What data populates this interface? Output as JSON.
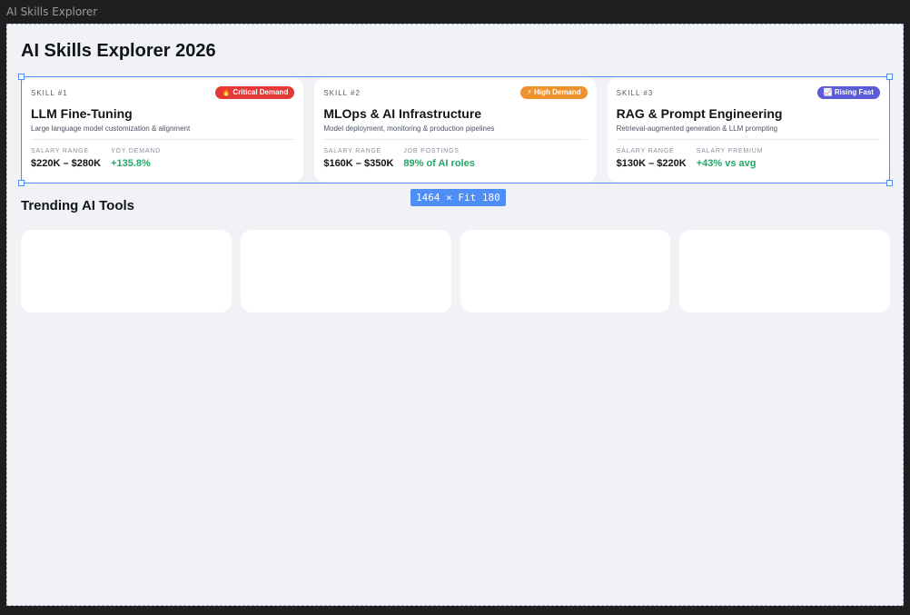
{
  "window": {
    "title": "AI Skills Explorer"
  },
  "page": {
    "title": "AI Skills Explorer 2026"
  },
  "selection": {
    "size_label": "1464 × Fit 180"
  },
  "skills": [
    {
      "number": "SKILL #1",
      "badge": "🔥 Critical Demand",
      "badge_color": "#e53935",
      "name": "LLM Fine-Tuning",
      "description": "Large language model customization & alignment",
      "stat1_label": "SALARY RANGE",
      "stat1_value": "$220K – $280K",
      "stat2_label": "YOY DEMAND",
      "stat2_value": "+135.8%"
    },
    {
      "number": "SKILL #2",
      "badge": "⚡ High Demand",
      "badge_color": "#f0922b",
      "name": "MLOps & AI Infrastructure",
      "description": "Model deployment, monitoring & production pipelines",
      "stat1_label": "SALARY RANGE",
      "stat1_value": "$160K – $350K",
      "stat2_label": "JOB POSTINGS",
      "stat2_value": "89% of AI roles"
    },
    {
      "number": "SKILL #3",
      "badge": "📈 Rising Fast",
      "badge_color": "#5b5bd6",
      "name": "RAG & Prompt Engineering",
      "description": "Retrieval-augmented generation & LLM prompting",
      "stat1_label": "SALARY RANGE",
      "stat1_value": "$130K – $220K",
      "stat2_label": "SALARY PREMIUM",
      "stat2_value": "+43% vs avg"
    }
  ],
  "tools_section": {
    "title": "Trending AI Tools"
  },
  "colors": {
    "accent": "#4f8ef7",
    "positive": "#22a866"
  }
}
